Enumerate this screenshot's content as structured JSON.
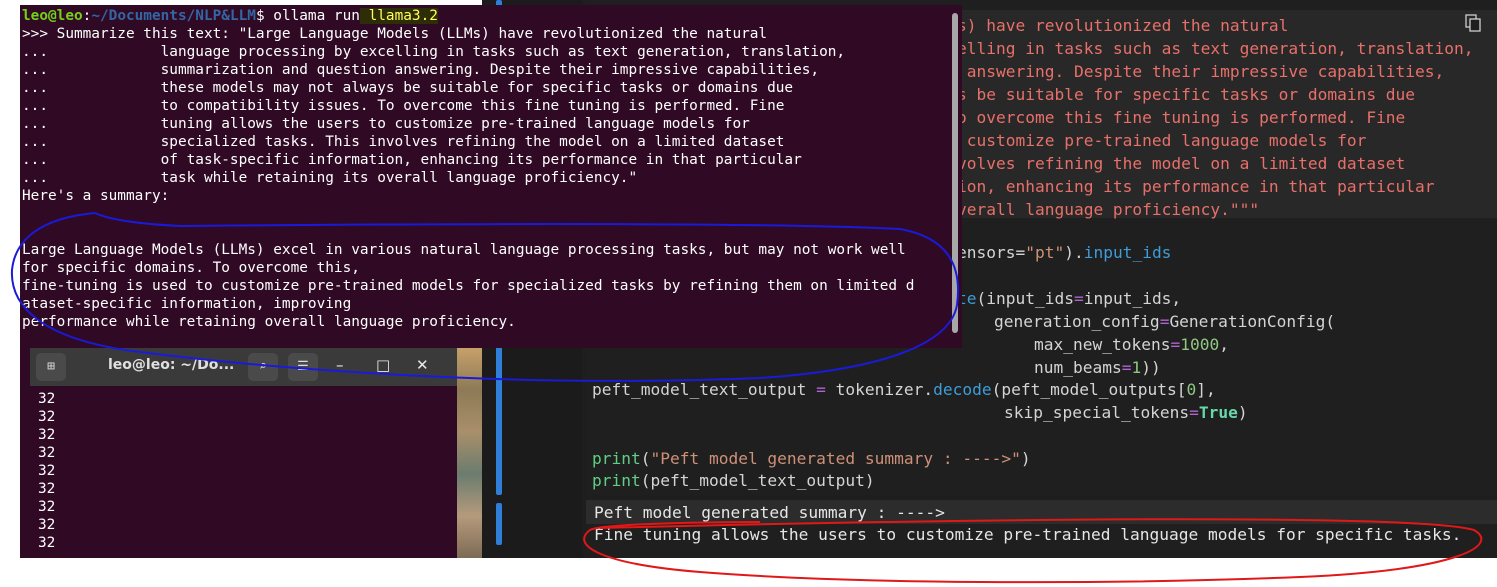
{
  "terminal_main": {
    "prompt_user": "leo@leo",
    "prompt_sep": ":",
    "prompt_path": "~/Documents/NLP&LLM",
    "prompt_dollar": "$ ",
    "command": "ollama run",
    "model": " llama3.2",
    "lines": [
      ">>> Summarize this text: \"Large Language Models (LLMs) have revolutionized the natural",
      "...             language processing by excelling in tasks such as text generation, translation,",
      "...             summarization and question answering. Despite their impressive capabilities,",
      "...             these models may not always be suitable for specific tasks or domains due",
      "...             to compatibility issues. To overcome this fine tuning is performed. Fine",
      "...             tuning allows the users to customize pre-trained language models for",
      "...             specialized tasks. This involves refining the model on a limited dataset",
      "...             of task-specific information, enhancing its performance in that particular",
      "...             task while retaining its overall language proficiency.\"",
      "Here's a summary:"
    ],
    "response": [
      "Large Language Models (LLMs) excel in various natural language processing tasks, but may not work well",
      "for specific domains. To overcome this,",
      "fine-tuning is used to customize pre-trained models for specialized tasks by refining them on limited d",
      "ataset-specific information, improving",
      "performance while retaining overall language proficiency."
    ]
  },
  "terminal_second": {
    "title": "leo@leo: ~/Do...",
    "new_tab_icon": "new-tab-icon",
    "search_icon": "search-icon",
    "menu_icon": "hamburger-menu-icon",
    "minimize": "–",
    "maximize": "□",
    "close": "✕",
    "numbers": [
      "32",
      "32",
      "32",
      "32",
      "32",
      "32",
      "32",
      "32",
      "32"
    ]
  },
  "notebook": {
    "code_top_lines": [
      "s) have revolutionized the natural",
      "elling in tasks such as text generation, translation,",
      " answering. Despite their impressive capabilities,",
      "s be suitable for specific tasks or domains due",
      "o overcome this fine tuning is performed. Fine",
      " customize pre-trained language models for",
      "volves refining the model on a limited dataset",
      "ion, enhancing its performance in that particular",
      "verall language proficiency.\"\"\""
    ],
    "line_tensors_a": "ensors=",
    "line_tensors_b": "\"pt\"",
    "line_tensors_c": ").",
    "line_tensors_d": "input_ids",
    "gen_a": "te",
    "gen_b": "(input_ids",
    "gen_c": "=",
    "gen_d": "input_ids,",
    "cfg_a": "generation_config",
    "cfg_b": "=",
    "cfg_c": "GenerationConfig(",
    "mnt_a": "max_new_tokens",
    "mnt_b": "=",
    "mnt_c": "1000",
    "mnt_d": ",",
    "nb_a": "num_beams",
    "nb_b": "=",
    "nb_c": "1",
    "nb_d": "))",
    "dec_a": "peft_model_text_output ",
    "dec_b": "=",
    "dec_c": " tokenizer.",
    "dec_d": "decode",
    "dec_e": "(peft_model_outputs[",
    "dec_f": "0",
    "dec_g": "],",
    "sst_a": "skip_special_tokens",
    "sst_b": "=",
    "sst_c": "True",
    "sst_d": ")",
    "print1_a": "print",
    "print1_b": "(",
    "print1_c": "\"Peft model generated summary : ---->\"",
    "print1_d": ")",
    "print2_a": "print",
    "print2_b": "(peft_model_text_output)",
    "copy_icon": "copy-icon",
    "output_lines": [
      "Peft model generated summary : ---->",
      "Fine tuning allows the users to customize pre-trained language models for specific tasks."
    ]
  },
  "annotations": {
    "blue_color": "#1a1adb",
    "red_color": "#e01818"
  }
}
